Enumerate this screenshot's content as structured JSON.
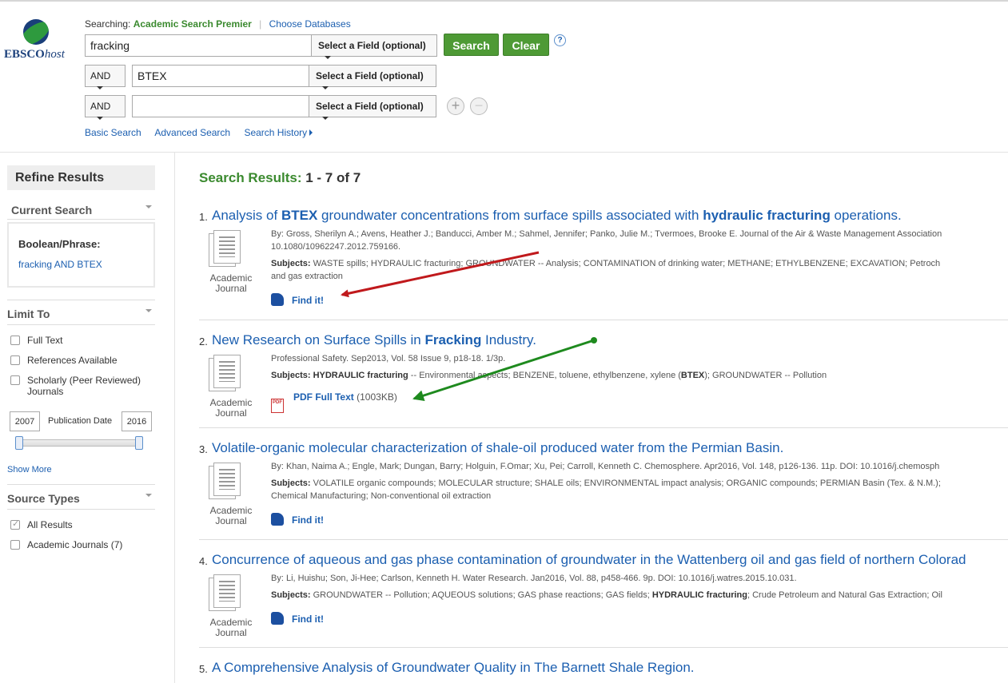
{
  "header": {
    "logo_text_a": "EBSCO",
    "logo_text_b": "host",
    "searching_label": "Searching:",
    "database": "Academic Search Premier",
    "choose_databases": "Choose Databases",
    "rows": [
      {
        "bool": "",
        "term": "fracking",
        "field": "Select a Field (optional)"
      },
      {
        "bool": "AND",
        "term": "BTEX",
        "field": "Select a Field (optional)"
      },
      {
        "bool": "AND",
        "term": "",
        "field": "Select a Field (optional)"
      }
    ],
    "search_label": "Search",
    "clear_label": "Clear",
    "help_label": "?",
    "add_row": "+",
    "remove_row": "−",
    "nav": {
      "basic": "Basic Search",
      "advanced": "Advanced Search",
      "history": "Search History"
    }
  },
  "sidebar": {
    "refine_title": "Refine Results",
    "current_search": "Current Search",
    "boolean_label": "Boolean/Phrase:",
    "boolean_value": "fracking AND BTEX",
    "limit_to": "Limit To",
    "limits": [
      {
        "label": "Full Text",
        "checked": false
      },
      {
        "label": "References Available",
        "checked": false
      },
      {
        "label": "Scholarly (Peer Reviewed)",
        "label2": "Journals",
        "checked": false
      }
    ],
    "date_from": "2007",
    "date_to": "2016",
    "publication_date": "Publication Date",
    "date_range_fraction": [
      0.0,
      1.0
    ],
    "show_more": "Show More",
    "source_types": "Source Types",
    "sources": [
      {
        "label": "All Results",
        "checked": true
      },
      {
        "label": "Academic Journals",
        "count": "(7)",
        "checked": false
      }
    ]
  },
  "results": {
    "label": "Search Results:",
    "range": "1 - 7 of 7",
    "type_label_1": "Academic",
    "type_label_2": "Journal",
    "find_it": "Find it!",
    "pdf_full_text": "PDF Full Text",
    "pdf_icon_text": "PDF",
    "items": [
      {
        "num": "1.",
        "title_parts": [
          "Analysis of ",
          "BTEX",
          " groundwater concentrations from surface spills associated with ",
          "hydraulic fracturing",
          " operations."
        ],
        "byline": "By: Gross, Sherilyn A.; Avens, Heather J.; Banducci, Amber M.; Sahmel, Jennifer; Panko, Julie M.; Tvermoes, Brooke E. Journal of the Air & Waste Management Association",
        "byline2": "10.1080/10962247.2012.759166.",
        "subjects_label": "Subjects:",
        "subjects": " WASTE spills; HYDRAULIC fracturing; GROUNDWATER -- Analysis; CONTAMINATION of drinking water; METHANE; ETHYLBENZENE; EXCAVATION; Petroch",
        "subjects2": "and gas extraction"
      },
      {
        "num": "2.",
        "title_parts": [
          "New Research on Surface Spills in ",
          "Fracking",
          " Industry."
        ],
        "byline": "Professional Safety. Sep2013, Vol. 58 Issue 9, p18-18. 1/3p.",
        "subjects_label": "Subjects:",
        "subjects_a": " HYDRAULIC fracturing",
        "subjects_b": " -- Environmental aspects; BENZENE, toluene, ethylbenzene, xylene (",
        "subjects_c": "BTEX",
        "subjects_d": "); GROUNDWATER -- Pollution",
        "pdf_size": "(1003KB)"
      },
      {
        "num": "3.",
        "title": "Volatile-organic molecular characterization of shale-oil produced water from the Permian Basin.",
        "byline": "By: Khan, Naima A.; Engle, Mark; Dungan, Barry; Holguin, F.Omar; Xu, Pei; Carroll, Kenneth C. Chemosphere. Apr2016, Vol. 148, p126-136. 11p. DOI: 10.1016/j.chemosph",
        "subjects_label": "Subjects:",
        "subjects": " VOLATILE organic compounds; MOLECULAR structure; SHALE oils; ENVIRONMENTAL impact analysis; ORGANIC compounds; PERMIAN Basin (Tex. & N.M.);",
        "subjects2": "Chemical Manufacturing; Non-conventional oil extraction"
      },
      {
        "num": "4.",
        "title": "Concurrence of aqueous and gas phase contamination of groundwater in the Wattenberg oil and gas field of northern Colorad",
        "byline": "By: Li, Huishu; Son, Ji-Hee; Carlson, Kenneth H. Water Research. Jan2016, Vol. 88, p458-466. 9p. DOI: 10.1016/j.watres.2015.10.031.",
        "subjects_label": "Subjects:",
        "subjects_a": " GROUNDWATER -- Pollution; AQUEOUS solutions; GAS phase reactions; GAS fields; ",
        "subjects_b": "HYDRAULIC fracturing",
        "subjects_c": "; Crude Petroleum and Natural Gas Extraction; Oil"
      },
      {
        "num": "5.",
        "title": "A Comprehensive Analysis of Groundwater Quality in The Barnett Shale Region."
      }
    ]
  },
  "colors": {
    "accent_green": "#4e9a35",
    "link_blue": "#1c5fb0",
    "arrow_red": "#c0191c",
    "arrow_green": "#1e8a1e"
  }
}
